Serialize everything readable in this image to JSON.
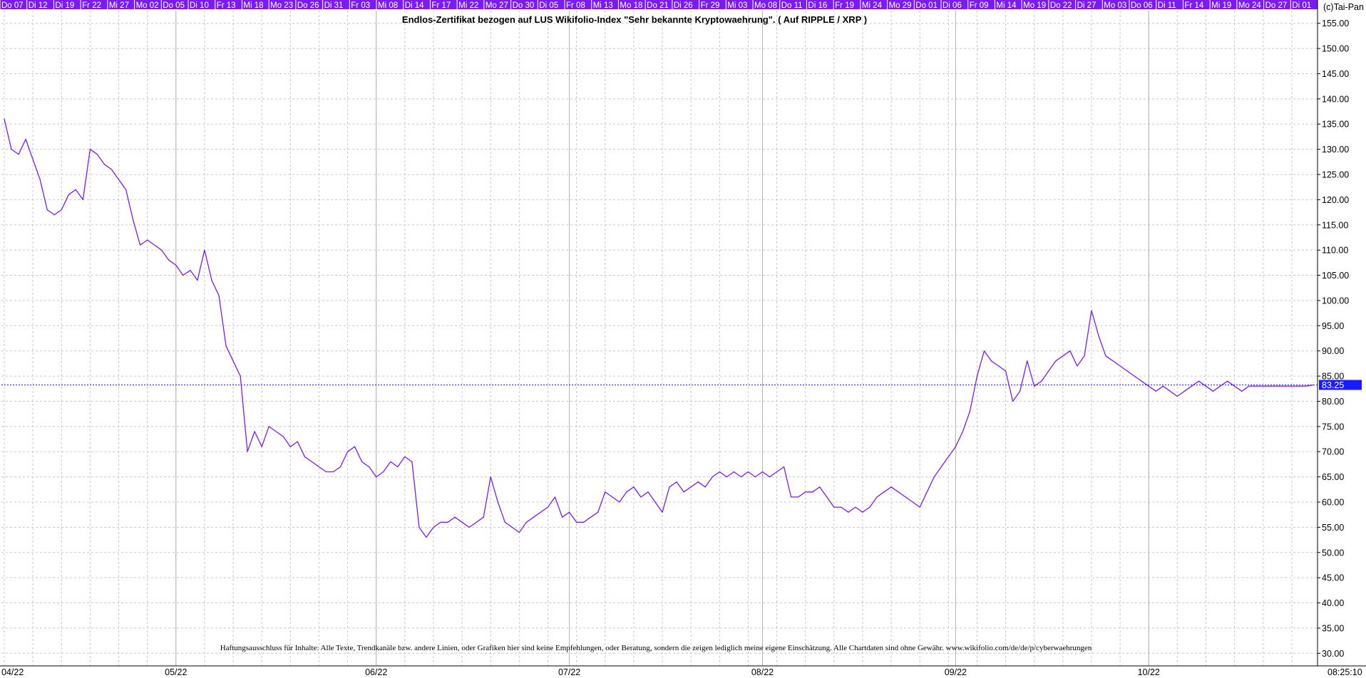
{
  "copyright": "(c)Tai-Pan",
  "time": "08:25:10",
  "disclaimer": "Haftungsausschluss für Inhalte: Alle Texte, Trendkanäle bzw. andere Linien, oder Grafiken hier sind keine Empfehlungen, oder Beratung, sondern die zeigen lediglich meine eigene Einschätzung. Alle Chartdaten sind ohne Gewähr. www.wikifolio.com/de/de/p/cyberwaehrungen",
  "day_labels": [
    "Do 07",
    "Di 12",
    "Di 19",
    "Fr 22",
    "Mi 27",
    "Mo 02",
    "Do 05",
    "Di 10",
    "Fr 13",
    "Mi 18",
    "Mo 23",
    "Do 26",
    "Di 31",
    "Fr 03",
    "Mi 08",
    "Di 14",
    "Fr 17",
    "Mi 22",
    "Mo 27",
    "Do 30",
    "Di 05",
    "Fr 08",
    "Mi 13",
    "Mo 18",
    "Do 21",
    "Di 26",
    "Fr 29",
    "Mi 03",
    "Mo 08",
    "Do 11",
    "Di 16",
    "Fr 19",
    "Mi 24",
    "Mo 29",
    "Do 01",
    "Di 06",
    "Fr 09",
    "Mi 14",
    "Mo 19",
    "Do 22",
    "Di 27",
    "Mo 03",
    "Do 06",
    "Di 11",
    "Fr 14",
    "Mi 19",
    "Mo 24",
    "Do 27",
    "Di 01"
  ],
  "colors": {
    "line": "#7a1cf0",
    "last_marker": "#1a1aff",
    "day_bar": "#7a1cf0",
    "grid": "#c8c8c8"
  },
  "chart_data": {
    "type": "line",
    "title": "Endlos-Zertifikat bezogen auf LUS Wikifolio-Index \"Sehr bekannte Kryptowaehrung\". ( Auf RIPPLE / XRP )",
    "xlabel": "",
    "ylabel": "",
    "ylim": [
      27.5,
      157.5
    ],
    "yticks": [
      30,
      35,
      40,
      45,
      50,
      55,
      60,
      65,
      70,
      75,
      80,
      85,
      90,
      95,
      100,
      105,
      110,
      115,
      120,
      125,
      130,
      135,
      140,
      145,
      150,
      155
    ],
    "month_labels": [
      "04/22",
      "05/22",
      "06/22",
      "07/22",
      "08/22",
      "09/22",
      "10/22"
    ],
    "month_positions": [
      0,
      24,
      52,
      79,
      106,
      133,
      160
    ],
    "last_value": 83.25,
    "grid": true,
    "series": [
      {
        "x": [
          0,
          1,
          2,
          3,
          4,
          5,
          6,
          7,
          8,
          9,
          10,
          11,
          12,
          13,
          14,
          15,
          16,
          17,
          18,
          19,
          20,
          21,
          22,
          23,
          24,
          25,
          26,
          27,
          28,
          29,
          30,
          31,
          32,
          33,
          34,
          35,
          36,
          37,
          38,
          39,
          40,
          41,
          42,
          43,
          44,
          45,
          46,
          47,
          48,
          49,
          50,
          51,
          52,
          53,
          54,
          55,
          56,
          57,
          58,
          59,
          60,
          61,
          62,
          63,
          64,
          65,
          66,
          67,
          68,
          69,
          70,
          71,
          72,
          73,
          74,
          75,
          76,
          77,
          78,
          79,
          80,
          81,
          82,
          83,
          84,
          85,
          86,
          87,
          88,
          89,
          90,
          91,
          92,
          93,
          94,
          95,
          96,
          97,
          98,
          99,
          100,
          101,
          102,
          103,
          104,
          105,
          106,
          107,
          108,
          109,
          110,
          111,
          112,
          113,
          114,
          115,
          116,
          117,
          118,
          119,
          120,
          121,
          122,
          123,
          124,
          125,
          126,
          127,
          128,
          129,
          130,
          131,
          132,
          133,
          134,
          135,
          136,
          137,
          138,
          139,
          140,
          141,
          142,
          143,
          144,
          145,
          146,
          147,
          148,
          149,
          150,
          151,
          152,
          153,
          154,
          155,
          156,
          157,
          158,
          159,
          160,
          161,
          162,
          163,
          164,
          165,
          166,
          167,
          168,
          169,
          170,
          171,
          172,
          173,
          174,
          175,
          176,
          177,
          178,
          179,
          180,
          181,
          182,
          183
        ],
        "values": [
          136,
          130,
          129,
          132,
          128,
          124,
          118,
          117,
          118,
          121,
          122,
          120,
          130,
          129,
          127,
          126,
          124,
          122,
          116,
          111,
          112,
          111,
          110,
          108,
          107,
          105,
          106,
          104,
          110,
          104,
          101,
          91,
          88,
          85,
          70,
          74,
          71,
          75,
          74,
          73,
          71,
          72,
          69,
          68,
          67,
          66,
          66,
          67,
          70,
          71,
          68,
          67,
          65,
          66,
          68,
          67,
          69,
          68,
          55,
          53,
          55,
          56,
          56,
          57,
          56,
          55,
          56,
          57,
          65,
          60,
          56,
          55,
          54,
          56,
          57,
          58,
          59,
          61,
          57,
          58,
          56,
          56,
          57,
          58,
          62,
          61,
          60,
          62,
          63,
          61,
          62,
          60,
          58,
          63,
          64,
          62,
          63,
          64,
          63,
          65,
          66,
          65,
          66,
          65,
          66,
          65,
          66,
          65,
          66,
          67,
          61,
          61,
          62,
          62,
          63,
          61,
          59,
          59,
          58,
          59,
          58,
          59,
          61,
          62,
          63,
          62,
          61,
          60,
          59,
          62,
          65,
          67,
          69,
          71,
          74,
          78,
          85,
          90,
          88,
          87,
          86,
          80,
          82,
          88,
          83,
          84,
          86,
          88,
          89,
          90,
          87,
          89,
          98,
          93,
          89,
          88,
          87,
          86,
          85,
          84,
          83,
          82,
          83,
          82,
          81,
          82,
          83,
          84,
          83,
          82,
          83,
          84,
          83,
          82,
          83,
          83,
          83,
          83,
          83,
          83,
          83,
          83,
          83,
          83.25
        ]
      }
    ]
  }
}
